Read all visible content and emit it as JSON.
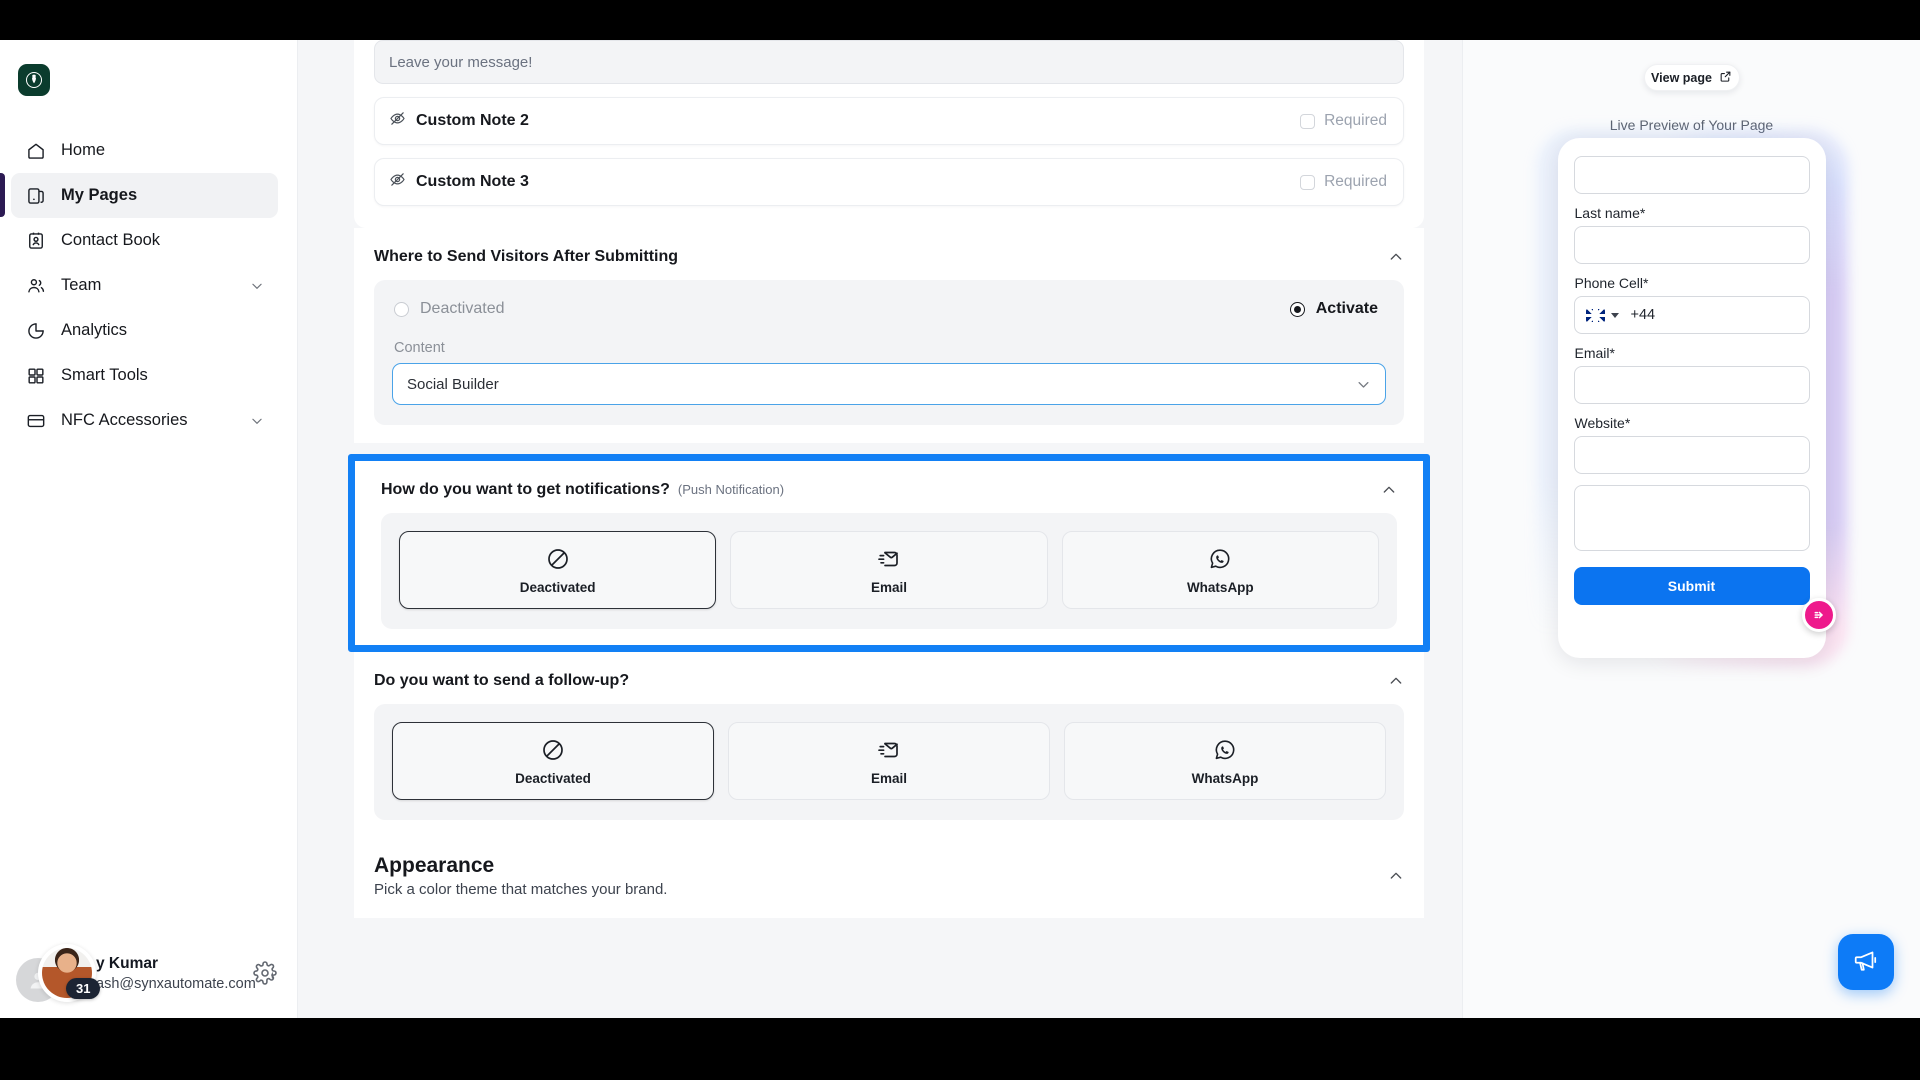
{
  "brand": {
    "logo_name": "starbucks-logo",
    "accent_blue": "#1280f5",
    "accent_indigo": "#2c1a53",
    "submit_blue": "#0b74f0",
    "fab_pink": "#ee1a8c"
  },
  "sidebar": {
    "items": [
      {
        "label": "Home",
        "icon": "home-icon",
        "active": false,
        "expandable": false
      },
      {
        "label": "My Pages",
        "icon": "pages-icon",
        "active": true,
        "expandable": false
      },
      {
        "label": "Contact Book",
        "icon": "contact-book-icon",
        "active": false,
        "expandable": false
      },
      {
        "label": "Team",
        "icon": "team-icon",
        "active": false,
        "expandable": true
      },
      {
        "label": "Analytics",
        "icon": "analytics-icon",
        "active": false,
        "expandable": false
      },
      {
        "label": "Smart Tools",
        "icon": "smart-tools-icon",
        "active": false,
        "expandable": false
      },
      {
        "label": "NFC Accessories",
        "icon": "nfc-card-icon",
        "active": false,
        "expandable": true
      }
    ],
    "profile": {
      "name": "y Kumar",
      "email": "ash@synxautomate.com",
      "badge": "31",
      "settings_icon": "gear-icon"
    }
  },
  "main": {
    "message_box": {
      "placeholder": "Leave your message!"
    },
    "custom_notes": [
      {
        "title": "Custom Note 2",
        "required_label": "Required",
        "icon": "eye-off-icon",
        "required_checked": false
      },
      {
        "title": "Custom Note 3",
        "required_label": "Required",
        "icon": "eye-off-icon",
        "required_checked": false
      }
    ],
    "redirect_section": {
      "title": "Where to Send Visitors After Submitting",
      "collapse_icon": "chevron-up-icon",
      "options": [
        {
          "label": "Deactivated",
          "selected": false
        },
        {
          "label": "Activate",
          "selected": true
        }
      ],
      "content_label": "Content",
      "content_value": "Social Builder"
    },
    "notifications_section": {
      "title": "How do you want to get notifications?",
      "subtitle": "(Push Notification)",
      "collapse_icon": "chevron-up-icon",
      "highlighted": true,
      "choices": [
        {
          "label": "Deactivated",
          "icon": "ban-icon",
          "selected": true
        },
        {
          "label": "Email",
          "icon": "mail-fast-icon",
          "selected": false
        },
        {
          "label": "WhatsApp",
          "icon": "whatsapp-icon",
          "selected": false
        }
      ]
    },
    "followup_section": {
      "title": "Do you want to send a follow-up?",
      "collapse_icon": "chevron-up-icon",
      "choices": [
        {
          "label": "Deactivated",
          "icon": "ban-icon",
          "selected": true
        },
        {
          "label": "Email",
          "icon": "mail-fast-icon",
          "selected": false
        },
        {
          "label": "WhatsApp",
          "icon": "whatsapp-icon",
          "selected": false
        }
      ]
    },
    "appearance_section": {
      "title": "Appearance",
      "subtitle": "Pick a color theme that matches your brand.",
      "collapse_icon": "chevron-up-icon"
    }
  },
  "preview": {
    "view_page_label": "View page",
    "view_page_icon": "external-link-icon",
    "caption": "Live Preview of Your Page",
    "form": {
      "first_field_value": "",
      "last_name_label": "Last name*",
      "last_name_value": "",
      "phone_label": "Phone Cell*",
      "phone_country_icon": "uk-flag-icon",
      "phone_prefix": "+44",
      "email_label": "Email*",
      "email_value": "",
      "website_label": "Website*",
      "website_value": "",
      "message_value": "",
      "submit_label": "Submit"
    },
    "fab_icon": "arrow-right-circle-icon"
  },
  "chat_widget": {
    "icon": "megaphone-icon"
  }
}
